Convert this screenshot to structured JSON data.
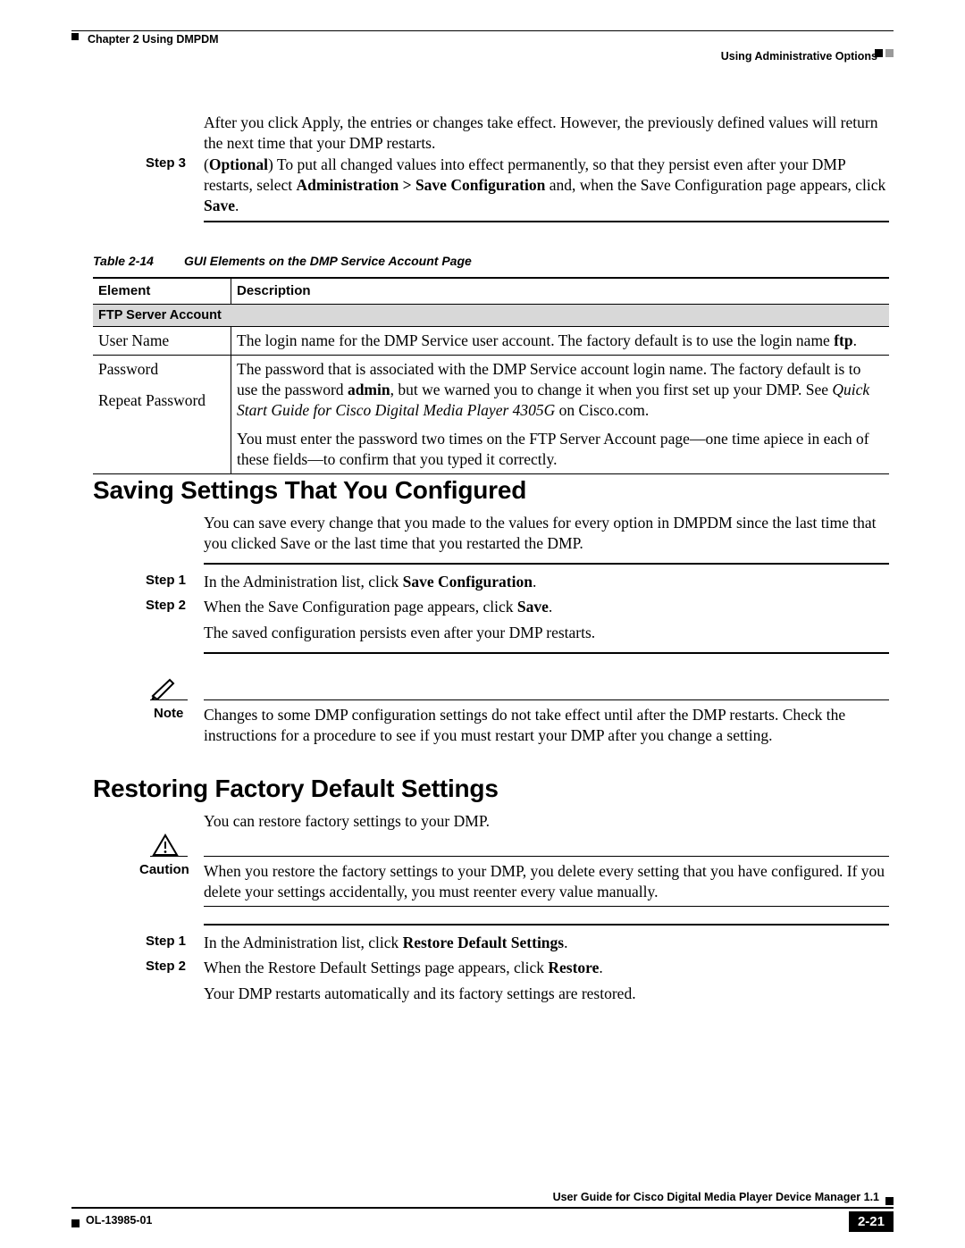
{
  "header": {
    "chapter": "Chapter 2      Using DMPDM",
    "section": "Using Administrative Options"
  },
  "intro": {
    "p1": "After you click Apply, the entries or changes take effect. However, the previously defined values will return the next time that your DMP restarts."
  },
  "step3": {
    "label": "Step 3",
    "pre": "(",
    "opt": "Optional",
    "post": ") To put all changed values into effect permanently, so that they persist even after your DMP restarts, select ",
    "nav": "Administration > Save Configuration",
    "mid": " and, when the Save Configuration page appears, click ",
    "save": "Save",
    "end": "."
  },
  "table": {
    "caption_num": "Table 2-14",
    "caption_title": "GUI Elements on the DMP Service Account Page",
    "h1": "Element",
    "h2": "Description",
    "section1": "FTP Server Account",
    "r1c1": "User Name",
    "r1c2a": "The login name for the DMP Service user account. The factory default is to use the login name ",
    "r1c2b": "ftp",
    "r1c2c": ".",
    "r2c1": "Password",
    "r3c1": "Repeat Password",
    "desc_p1a": "The password that is associated with the DMP Service account login name. The factory default is to use the password ",
    "desc_p1b": "admin",
    "desc_p1c": ", but we warned you to change it when you first set up your DMP. See ",
    "desc_p1d": "Quick Start Guide for Cisco Digital Media Player 4305G",
    "desc_p1e": " on Cisco.com.",
    "desc_p2": "You must enter the password two times on the FTP Server Account page—one time apiece in each of these fields—to confirm that you typed it correctly."
  },
  "saving": {
    "title": "Saving Settings That You Configured",
    "intro": "You can save every change that you made to the values for every option in DMPDM since the last time that you clicked Save or the last time that you restarted the DMP.",
    "s1_label": "Step 1",
    "s1a": "In the Administration list, click ",
    "s1b": "Save Configuration",
    "s1c": ".",
    "s2_label": "Step 2",
    "s2a": "When the Save Configuration page appears, click ",
    "s2b": "Save",
    "s2c": ".",
    "s2_p2": "The saved configuration persists even after your DMP restarts.",
    "note_label": "Note",
    "note_text": "Changes to some DMP configuration settings do not take effect until after the DMP restarts. Check the instructions for a procedure to see if you must restart your DMP after you change a setting."
  },
  "restore": {
    "title": "Restoring Factory Default Settings",
    "intro": "You can restore factory settings to your DMP.",
    "caution_label": "Caution",
    "caution_text": "When you restore the factory settings to your DMP, you delete every setting that you have configured. If you delete your settings accidentally, you must reenter every value manually.",
    "s1_label": "Step 1",
    "s1a": "In the Administration list, click ",
    "s1b": "Restore Default Settings",
    "s1c": ".",
    "s2_label": "Step 2",
    "s2a": "When the Restore Default Settings page appears, click ",
    "s2b": "Restore",
    "s2c": ".",
    "s2_p2": "Your DMP restarts automatically and its factory settings are restored."
  },
  "footer": {
    "guide": "User Guide for Cisco Digital Media Player Device Manager 1.1",
    "ol": "OL-13985-01",
    "page": "2-21"
  }
}
